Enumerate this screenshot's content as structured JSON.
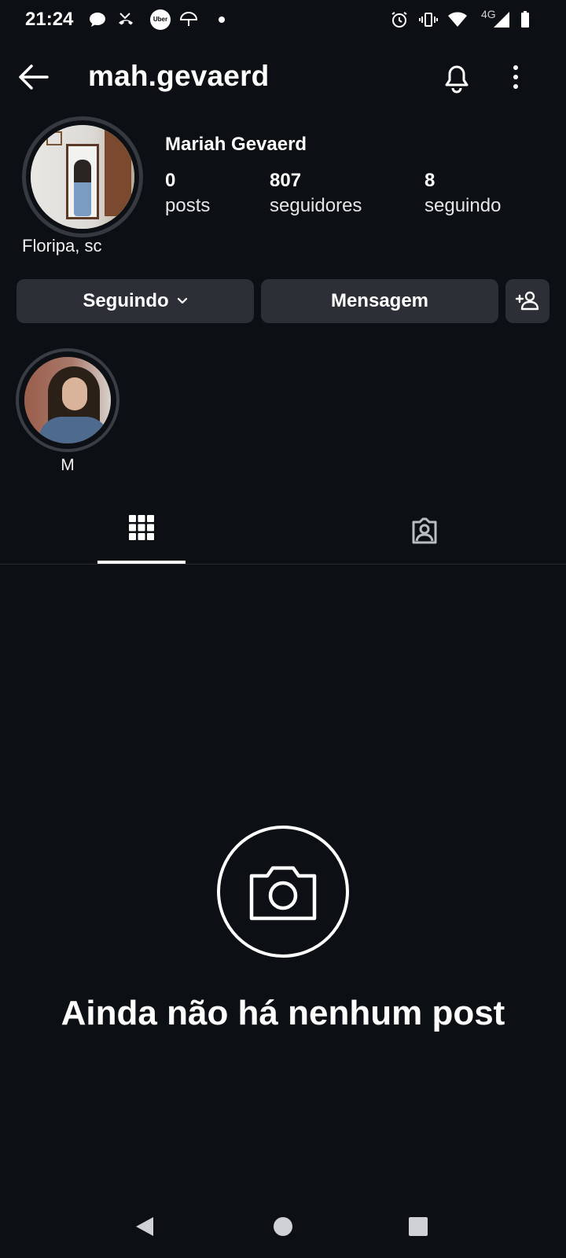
{
  "status_bar": {
    "time": "21:24",
    "network_label": "4G",
    "notification_icons": [
      "chat-bubble-icon",
      "missed-call-icon",
      "uber-app-icon",
      "umbrella-icon",
      "more-notifications-dot"
    ],
    "system_icons": [
      "alarm-icon",
      "vibrate-icon",
      "wifi-icon",
      "cell-signal-icon",
      "battery-icon"
    ],
    "uber_label": "Uber"
  },
  "header": {
    "username": "mah.gevaerd"
  },
  "profile": {
    "full_name": "Mariah Gevaerd",
    "location": "Floripa, sc",
    "stats": {
      "posts_count": "0",
      "posts_label": "posts",
      "followers_count": "807",
      "followers_label": "seguidores",
      "following_count": "8",
      "following_label": "seguindo"
    }
  },
  "actions": {
    "following_label": "Seguindo",
    "message_label": "Mensagem"
  },
  "highlights": [
    {
      "label": "M"
    }
  ],
  "tabs": [
    "grid-icon",
    "tagged-icon"
  ],
  "empty_state": {
    "text": "Ainda não há nenhum post"
  },
  "colors": {
    "background": "#0c1014",
    "button": "#2c3036",
    "text": "#ffffff"
  }
}
